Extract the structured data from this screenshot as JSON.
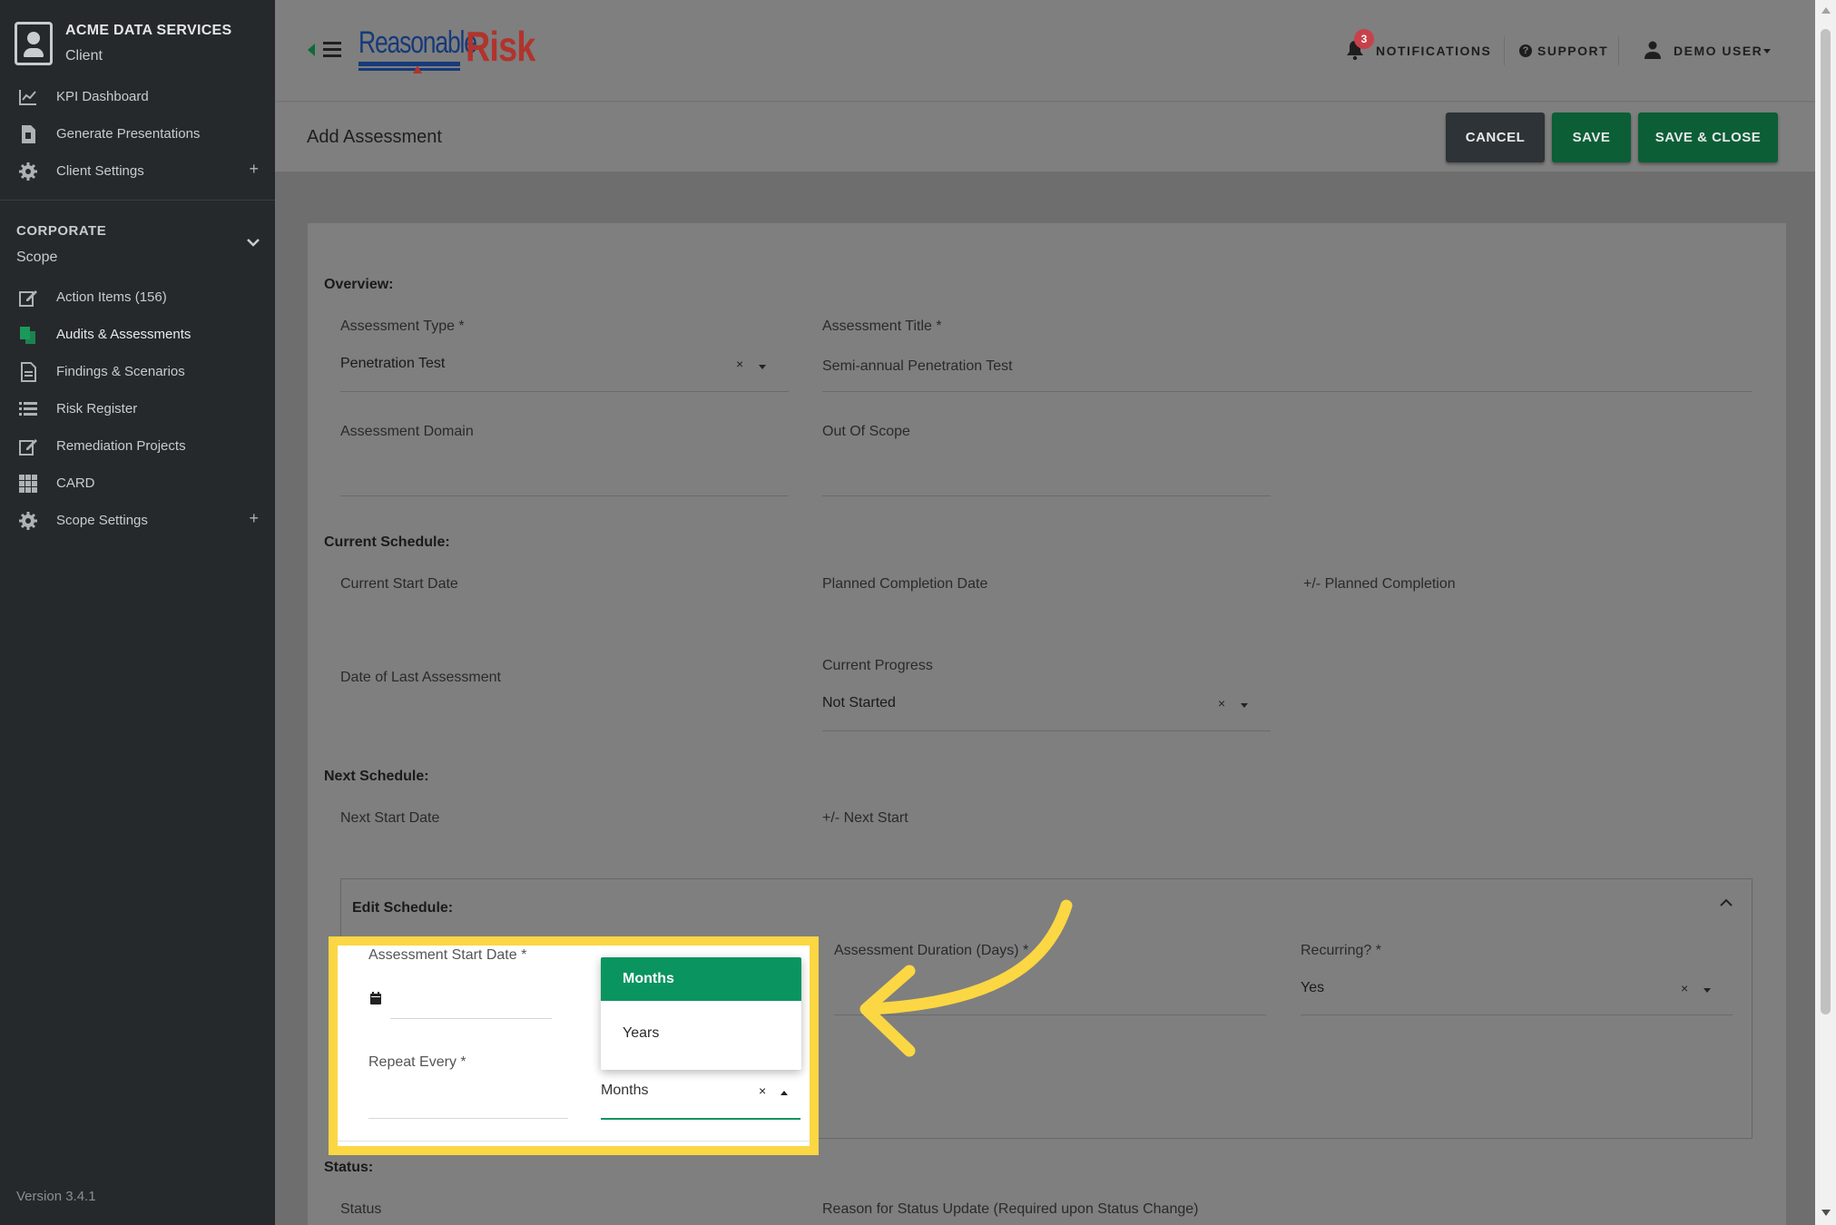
{
  "sidebar": {
    "client_name": "ACME DATA SERVICES",
    "client_role": "Client",
    "top_items": [
      {
        "label": "KPI Dashboard",
        "icon": "chart-line-icon"
      },
      {
        "label": "Generate Presentations",
        "icon": "file-powerpoint-icon"
      },
      {
        "label": "Client Settings",
        "icon": "gear-icon",
        "expand": "+"
      }
    ],
    "section_title": "CORPORATE",
    "section_sub": "Scope",
    "scope_items": [
      {
        "label": "Action Items (156)",
        "icon": "edit-icon"
      },
      {
        "label": "Audits & Assessments",
        "icon": "copy-icon",
        "active": true
      },
      {
        "label": "Findings & Scenarios",
        "icon": "document-icon"
      },
      {
        "label": "Risk Register",
        "icon": "list-icon"
      },
      {
        "label": "Remediation Projects",
        "icon": "edit-icon"
      },
      {
        "label": "CARD",
        "icon": "grid-icon"
      },
      {
        "label": "Scope Settings",
        "icon": "gear-icon",
        "expand": "+"
      }
    ],
    "version": "Version 3.4.1"
  },
  "header": {
    "logo_part1": "Reasonable",
    "logo_part2": "Risk",
    "notifications_label": "NOTIFICATIONS",
    "notifications_count": "3",
    "support_label": "SUPPORT",
    "user_label": "DEMO USER"
  },
  "titlebar": {
    "title": "Add Assessment",
    "cancel": "CANCEL",
    "save": "SAVE",
    "save_close": "SAVE & CLOSE"
  },
  "form": {
    "overview_title": "Overview:",
    "assessment_type_label": "Assessment Type *",
    "assessment_type_value": "Penetration Test",
    "assessment_title_label": "Assessment Title *",
    "assessment_title_value": "Semi-annual Penetration Test",
    "domain_label": "Assessment Domain",
    "out_of_scope_label": "Out Of Scope",
    "current_schedule_title": "Current Schedule:",
    "current_start_label": "Current Start Date",
    "planned_completion_label": "Planned Completion Date",
    "plus_minus_planned_label": "+/- Planned Completion",
    "last_assessment_label": "Date of Last Assessment",
    "current_progress_label": "Current Progress",
    "current_progress_value": "Not Started",
    "next_schedule_title": "Next Schedule:",
    "next_start_label": "Next Start Date",
    "plus_minus_next_label": "+/- Next Start",
    "edit_schedule_title": "Edit Schedule:",
    "start_date_label": "Assessment Start Date *",
    "duration_label": "Assessment Duration (Days) *",
    "recurring_label": "Recurring? *",
    "recurring_value": "Yes",
    "repeat_every_label": "Repeat Every *",
    "repeat_unit_value": "Months",
    "status_title": "Status:",
    "status_label": "Status",
    "reason_label": "Reason for Status Update (Required upon Status Change)",
    "clear_glyph": "×"
  },
  "dropdown": {
    "options": [
      "Months",
      "Years"
    ],
    "selected": "Months"
  },
  "colors": {
    "accent_green": "#0a9460",
    "highlight_yellow": "#fbd743",
    "badge_red": "#c7414b",
    "sidebar_bg": "#26292c"
  }
}
